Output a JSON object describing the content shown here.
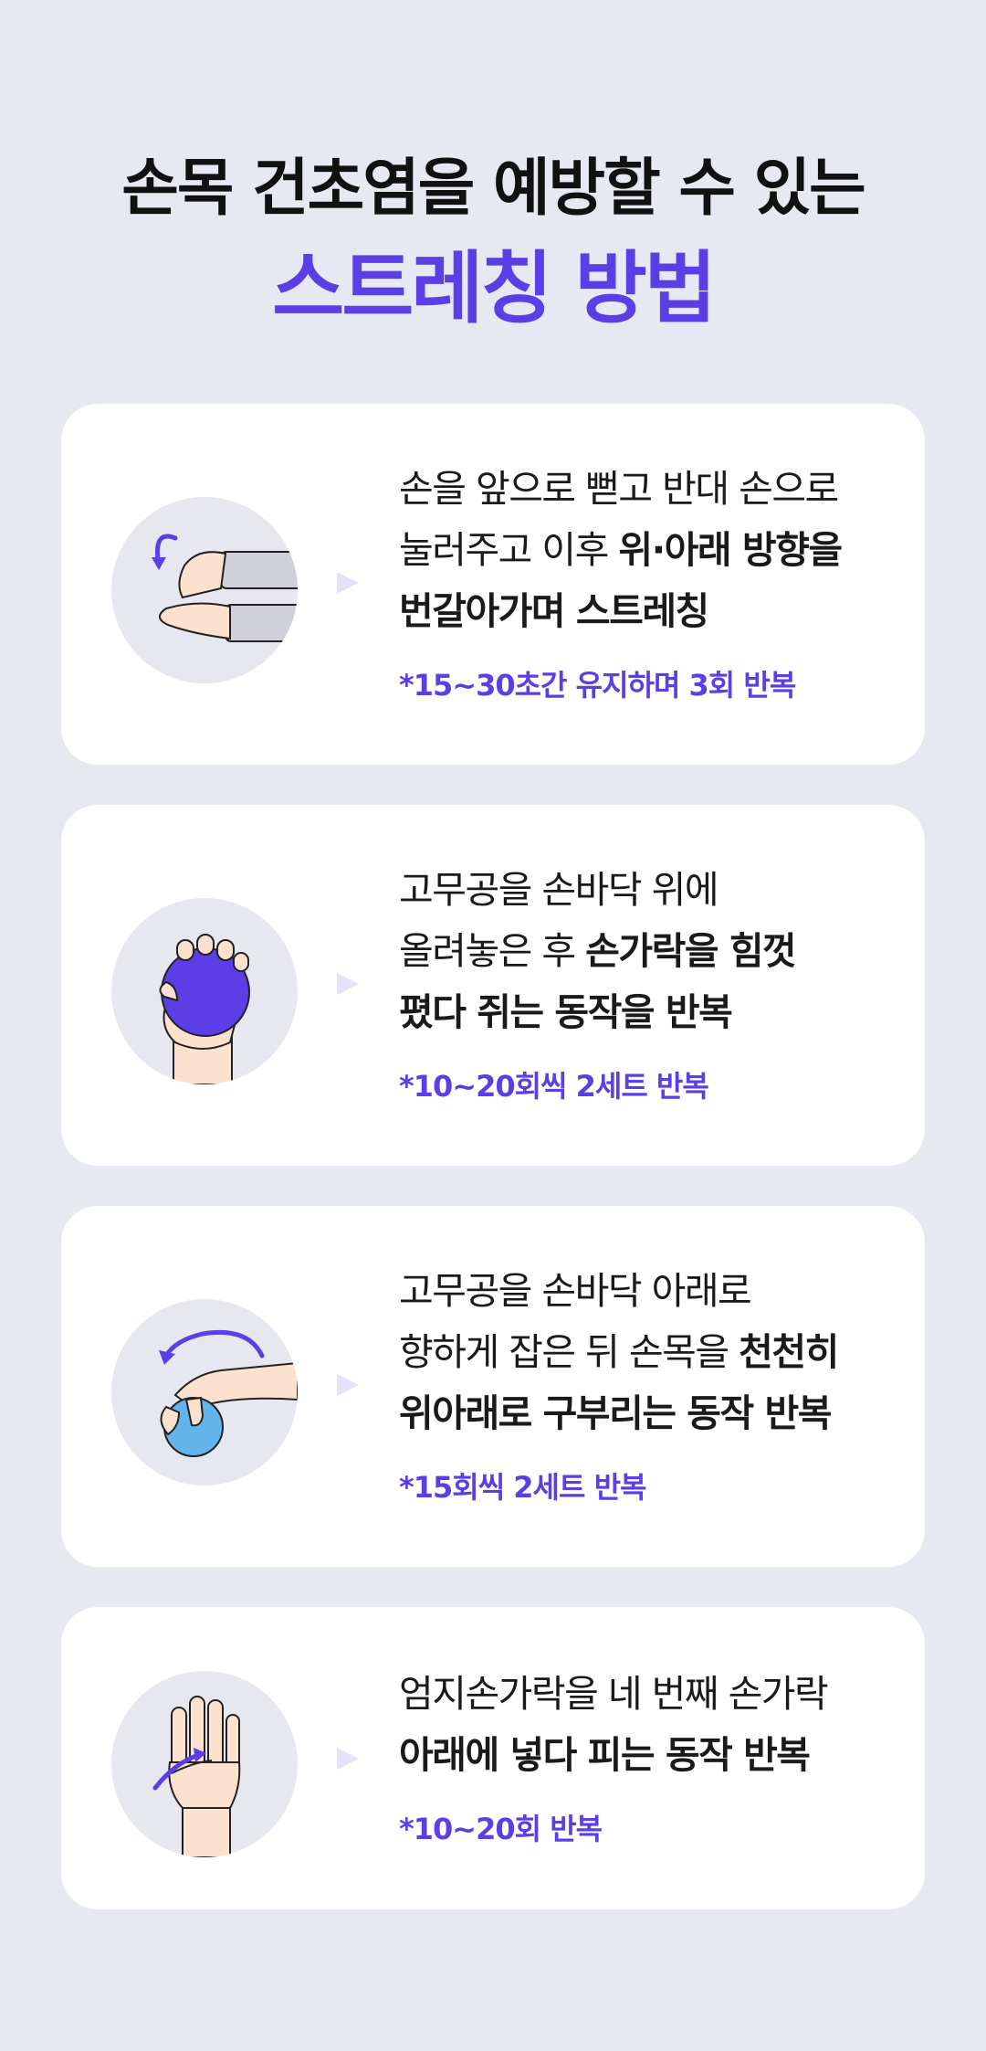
{
  "title": {
    "line1": "손목 건초염을 예방할 수 있는",
    "line2": "스트레칭 방법"
  },
  "colors": {
    "accent": "#5b3ee6",
    "background": "#e6e8f2",
    "card": "#ffffff"
  },
  "cards": [
    {
      "icon": "wrist-flex-stretch-illustration",
      "lines": [
        [
          "손을 앞으로 뻗고 반대 손으로",
          ""
        ],
        [
          "눌러주고 이후 ",
          "위·아래 방향을"
        ],
        [
          "",
          "번갈아가며 스트레칭"
        ]
      ],
      "note": "*15~30초간 유지하며 3회 반복"
    },
    {
      "icon": "rubber-ball-grip-illustration",
      "lines": [
        [
          "고무공을 손바닥 위에",
          ""
        ],
        [
          "올려놓은 후 ",
          "손가락을 힘껏"
        ],
        [
          "",
          "폈다 쥐는 동작을 반복"
        ]
      ],
      "note": "*10~20회씩 2세트 반복"
    },
    {
      "icon": "ball-wrist-curl-illustration",
      "lines": [
        [
          "고무공을 손바닥 아래로",
          ""
        ],
        [
          "향하게 잡은 뒤 손목을 ",
          "천천히"
        ],
        [
          "",
          "위아래로 구부리는 동작 반복"
        ]
      ],
      "note": "*15회씩 2세트 반복"
    },
    {
      "icon": "thumb-tuck-illustration",
      "lines": [
        [
          "엄지손가락을 네 번째 손가락",
          ""
        ],
        [
          "",
          "아래에 넣다 피는 동작 반복"
        ]
      ],
      "note": "*10~20회 반복"
    }
  ]
}
